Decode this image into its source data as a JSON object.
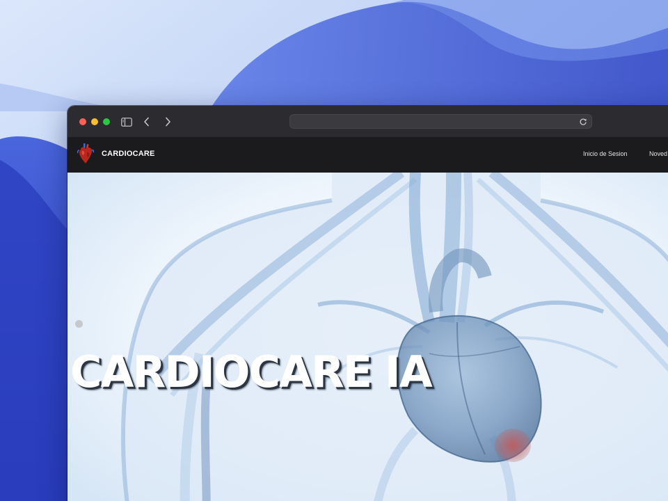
{
  "browser": {
    "address_bar": {
      "url": ""
    },
    "icons": {
      "sidebar": "sidebar-icon",
      "back": "chevron-left-icon",
      "forward": "chevron-right-icon",
      "reload": "reload-icon"
    }
  },
  "site": {
    "brand": {
      "name": "CARDIOCARE",
      "logo": "heart-logo-icon"
    },
    "nav": {
      "login_label": "Inicio de Sesion",
      "news_label": "Noved"
    },
    "hero": {
      "title": "CARDIOCARE IA",
      "image": "anatomical-heart-xray-illustration"
    }
  },
  "colors": {
    "nav_background": "#1b1b1d",
    "titlebar": "#2c2b2f",
    "traffic_close": "#ff5f57",
    "traffic_minimize": "#febc2e",
    "traffic_zoom": "#28c840",
    "hero_tint": "#3a6fb5"
  }
}
